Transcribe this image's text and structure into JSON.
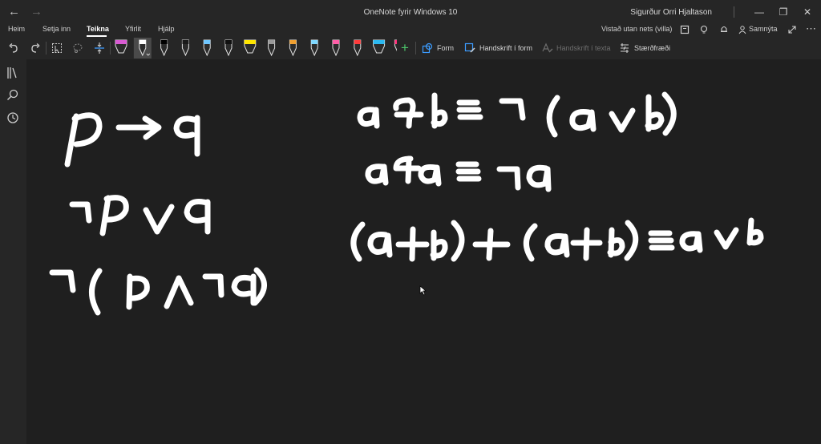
{
  "titlebar": {
    "title": "OneNote fyrir Windows 10",
    "user": "Sigurður Orri Hjaltason",
    "back_glyph": "←",
    "forward_glyph": "→",
    "minimize_glyph": "—",
    "restore_glyph": "❐",
    "close_glyph": "✕"
  },
  "menu": {
    "tabs": [
      {
        "label": "Heim"
      },
      {
        "label": "Setja inn"
      },
      {
        "label": "Teikna"
      },
      {
        "label": "Yfirlit"
      },
      {
        "label": "Hjálp"
      }
    ],
    "active_tab": "Teikna",
    "status": "Vistað utan nets (villa)",
    "share": "Samnýta",
    "more_glyph": "⋯"
  },
  "toolbar": {
    "form_label": "Form",
    "ink_to_shape_label": "Handskrift í form",
    "ink_to_text_label": "Handskrift í texta",
    "math_label": "Stærðfræði",
    "add_pen_glyph": "+",
    "pens": [
      {
        "name": "highlighter-pink",
        "color": "#d95bd3"
      },
      {
        "name": "pen-white-selected",
        "color": "#ffffff"
      },
      {
        "name": "pen-black",
        "color": "#000000"
      },
      {
        "name": "pen-black-2",
        "color": "#1a1a1a"
      },
      {
        "name": "pen-light-blue",
        "color": "#6ec6ff"
      },
      {
        "name": "pen-black-3",
        "color": "#111111"
      },
      {
        "name": "highlighter-yellow",
        "color": "#ffe600"
      },
      {
        "name": "pen-galaxy",
        "color": "#9a9a9a"
      },
      {
        "name": "pen-rainbow",
        "color": "#f0a030"
      },
      {
        "name": "pen-cyan",
        "color": "#7fd8ff"
      },
      {
        "name": "pen-pink",
        "color": "#ff5fa8"
      },
      {
        "name": "pen-red",
        "color": "#ff3b3b"
      },
      {
        "name": "highlighter-cyan",
        "color": "#2bb8f0"
      },
      {
        "name": "highlighter-magenta",
        "color": "#ff2f7a"
      }
    ]
  },
  "accent_color": "#3c9cff",
  "ink_color": "#ffffff"
}
